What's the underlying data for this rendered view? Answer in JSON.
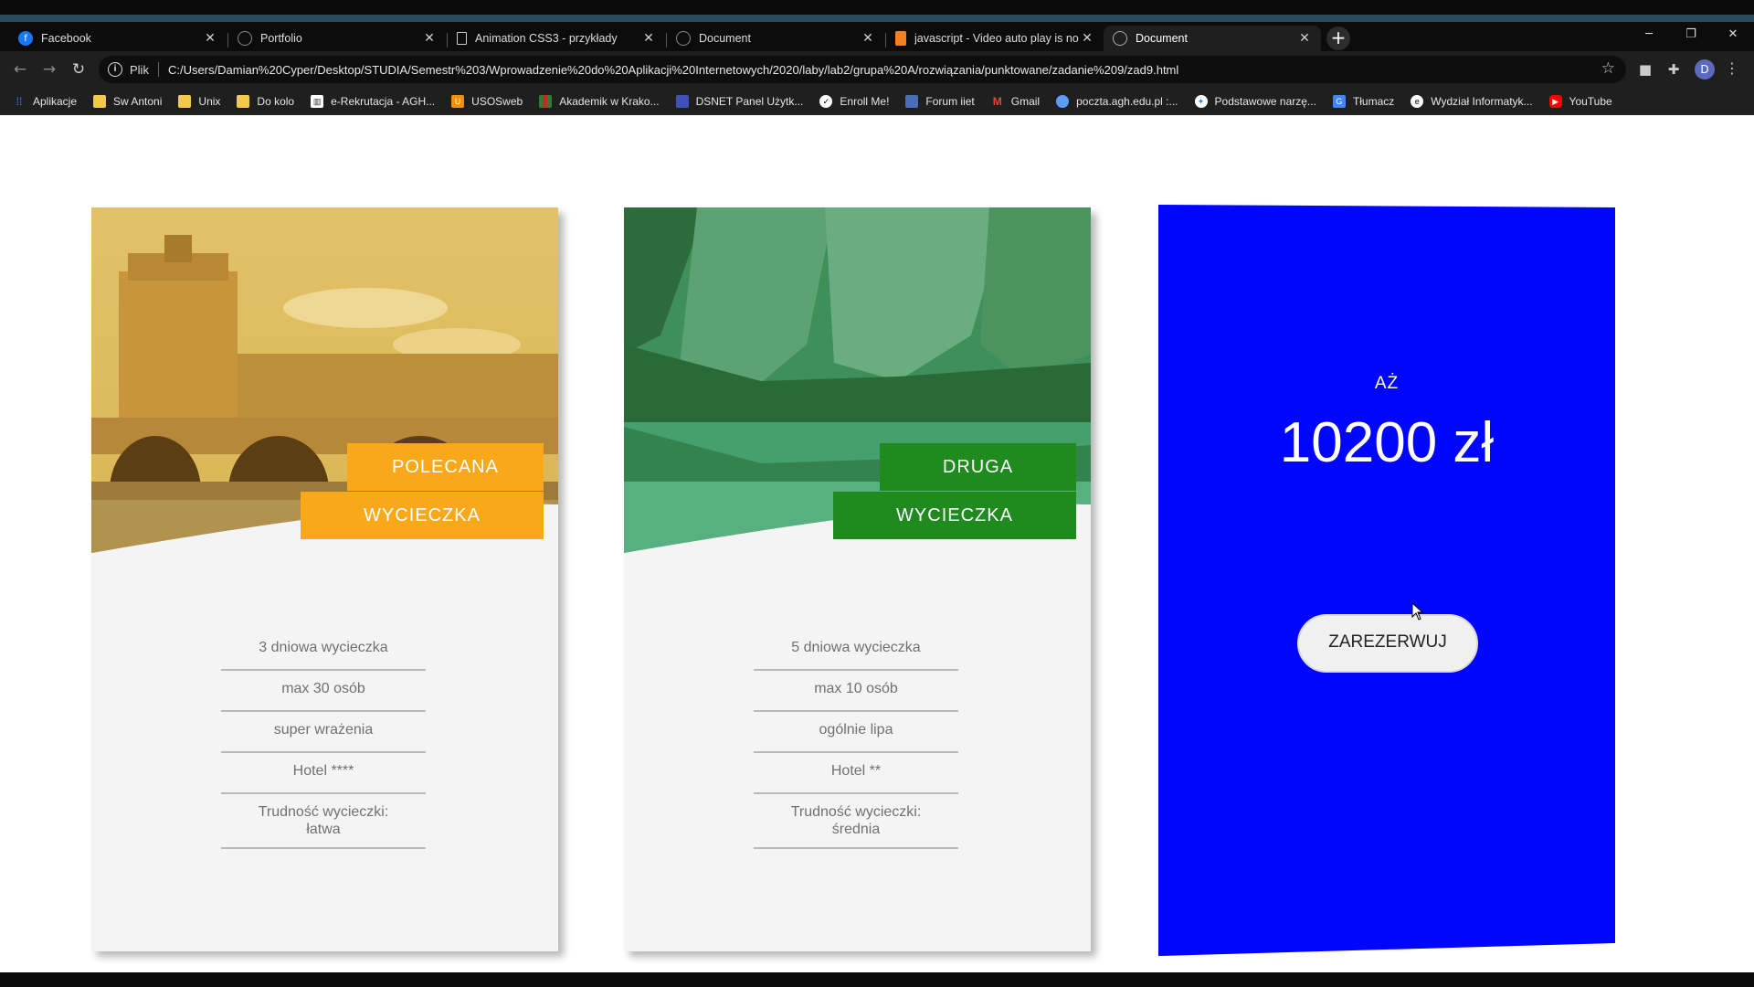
{
  "browser": {
    "tabs": [
      {
        "title": "Facebook",
        "icon": "facebook-icon",
        "color": "#1877f2"
      },
      {
        "title": "Portfolio",
        "icon": "globe-icon",
        "color": "#5f6368"
      },
      {
        "title": "Animation CSS3 - przykłady",
        "icon": "brackets-icon",
        "color": "#444"
      },
      {
        "title": "Document",
        "icon": "globe-icon",
        "color": "#5f6368"
      },
      {
        "title": "javascript - Video auto play is no",
        "icon": "stackoverflow-icon",
        "color": "#f48024"
      },
      {
        "title": "Document",
        "icon": "globe-icon",
        "color": "#5f6368"
      }
    ],
    "active_tab_index": 5,
    "address": {
      "scheme_label": "Plik",
      "url": "C:/Users/Damian%20Cyper/Desktop/STUDIA/Semestr%203/Wprowadzenie%20do%20Aplikacji%20Internetowych/2020/laby/lab2/grupa%20A/rozwiązania/punktowane/zadanie%209/zad9.html"
    },
    "profile_initial": "D",
    "bookmarks": [
      {
        "label": "Aplikacje",
        "icon": "apps-grid-icon",
        "color": "#4a8af4"
      },
      {
        "label": "Sw Antoni",
        "icon": "folder-icon",
        "color": "#f2c94c"
      },
      {
        "label": "Unix",
        "icon": "folder-icon",
        "color": "#f2c94c"
      },
      {
        "label": "Do kolo",
        "icon": "folder-icon",
        "color": "#f2c94c"
      },
      {
        "label": "e-Rekrutacja - AGH...",
        "icon": "agh-icon",
        "color": "#ffffff"
      },
      {
        "label": "USOSweb",
        "icon": "usos-icon",
        "color": "#f29100"
      },
      {
        "label": "Akademik w Krako...",
        "icon": "akademik-icon",
        "color": "#2e7d32"
      },
      {
        "label": "DSNET Panel Użytk...",
        "icon": "dsnet-icon",
        "color": "#3f51b5"
      },
      {
        "label": "Enroll Me!",
        "icon": "enroll-icon",
        "color": "#ffffff"
      },
      {
        "label": "Forum iiet",
        "icon": "forum-icon",
        "color": "#4b6cb7"
      },
      {
        "label": "Gmail",
        "icon": "gmail-icon",
        "color": "#ea4335"
      },
      {
        "label": "poczta.agh.edu.pl :...",
        "icon": "mail-agh-icon",
        "color": "#5c9cf5"
      },
      {
        "label": "Podstawowe narzę...",
        "icon": "tools-icon",
        "color": "#1e88e5"
      },
      {
        "label": "Tłumacz",
        "icon": "translate-icon",
        "color": "#4285f4"
      },
      {
        "label": "Wydział Informatyk...",
        "icon": "wydzial-icon",
        "color": "#ffffff"
      },
      {
        "label": "YouTube",
        "icon": "youtube-icon",
        "color": "#ff0000"
      }
    ]
  },
  "page": {
    "cards": [
      {
        "ribbon_top": "POLECANA",
        "ribbon_bottom": "WYCIECZKA",
        "ribbon_color": "#f9a819",
        "features": [
          "3 dniowa wycieczka",
          "max 30 osób",
          "super wrażenia",
          "Hotel ****"
        ],
        "difficulty_label": "Trudność wycieczki:",
        "difficulty_value": "łatwa"
      },
      {
        "ribbon_top": "DRUGA",
        "ribbon_bottom": "WYCIECZKA",
        "ribbon_color": "#1f8b1f",
        "features": [
          "5 dniowa wycieczka",
          "max 10 osób",
          "ogólnie lipa",
          "Hotel **"
        ],
        "difficulty_label": "Trudność wycieczki:",
        "difficulty_value": "średnia"
      }
    ],
    "offer": {
      "upto": "AŻ",
      "price": "10200 zł",
      "button": "ZAREZERWUJ",
      "color": "#0006fb"
    }
  }
}
